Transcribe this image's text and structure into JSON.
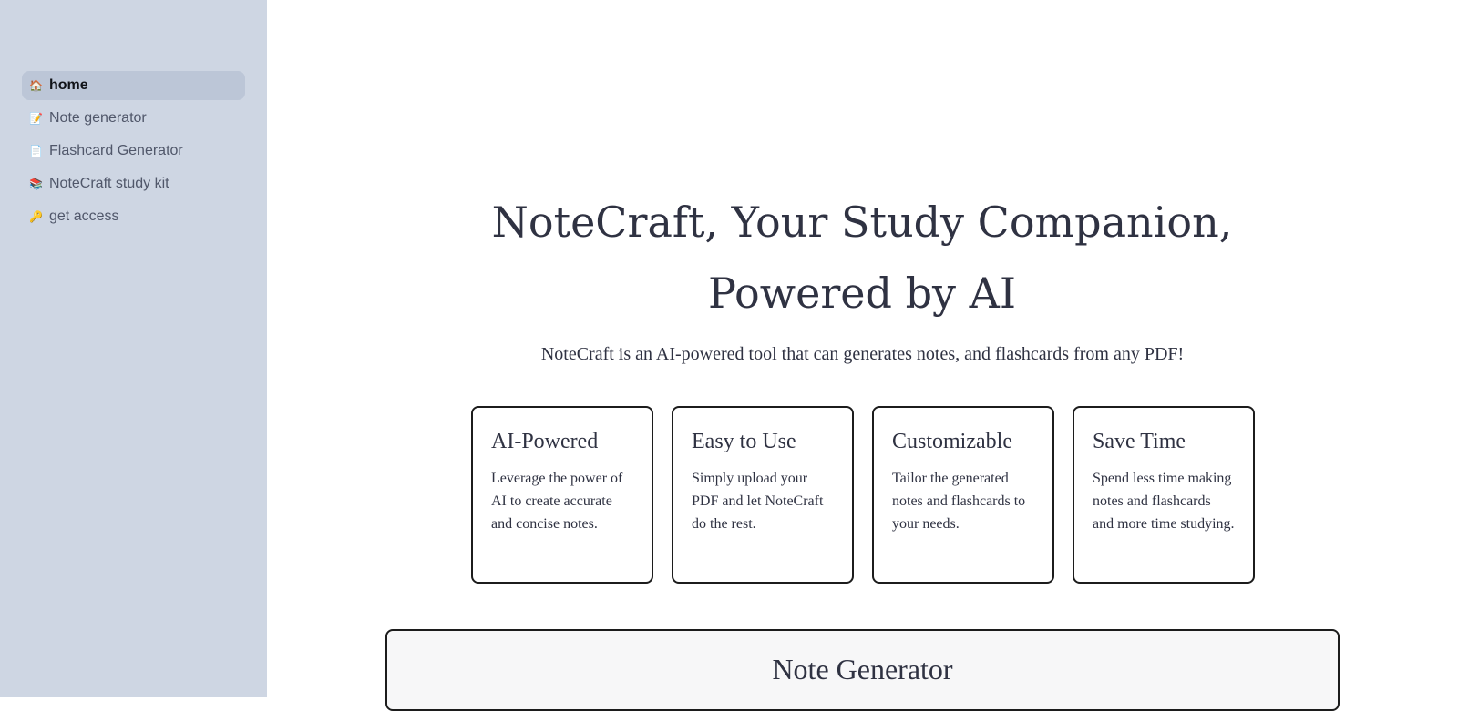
{
  "sidebar": {
    "items": [
      {
        "label": "home",
        "icon": "🏠",
        "icon_name": "house-icon",
        "active": true
      },
      {
        "label": "Note generator",
        "icon": "📝",
        "icon_name": "memo-icon",
        "active": false
      },
      {
        "label": "Flashcard Generator",
        "icon": "📄",
        "icon_name": "document-icon",
        "active": false
      },
      {
        "label": "NoteCraft study kit",
        "icon": "📚",
        "icon_name": "books-icon",
        "active": false
      },
      {
        "label": "get access",
        "icon": "🔑",
        "icon_name": "key-icon",
        "active": false
      }
    ]
  },
  "hero": {
    "title": "NoteCraft, Your Study Companion, Powered by AI",
    "subtitle": "NoteCraft is an AI-powered tool that can generates notes, and flashcards from any PDF!"
  },
  "features": [
    {
      "title": "AI-Powered",
      "description": "Leverage the power of AI to create accurate and concise notes."
    },
    {
      "title": "Easy to Use",
      "description": "Simply upload your PDF and let NoteCraft do the rest."
    },
    {
      "title": "Customizable",
      "description": "Tailor the generated notes and flashcards to your needs."
    },
    {
      "title": "Save Time",
      "description": "Spend less time making notes and flashcards and more time studying."
    }
  ],
  "generator": {
    "title": "Note Generator"
  },
  "colors": {
    "sidebar_bg": "#ced6e3",
    "active_item_bg": "#bcc6d7",
    "text": "#2f3242",
    "panel_bg": "#f7f7f8"
  }
}
